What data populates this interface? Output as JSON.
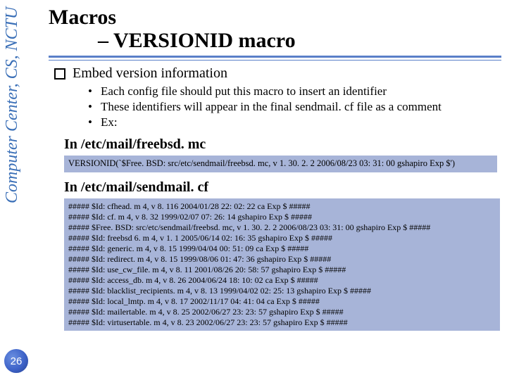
{
  "sidebar": {
    "label": "Computer Center, CS, NCTU"
  },
  "page_number": "26",
  "title": "Macros",
  "subtitle": "– VERSIONID macro",
  "bullet": "Embed version information",
  "subpoints": [
    "Each config file should put this macro to insert an identifier",
    "These identifiers will appear in the final sendmail. cf file as a comment",
    "Ex:"
  ],
  "heading_mc": "In /etc/mail/freebsd. mc",
  "mc_line": "VERSIONID(`$Free. BSD: src/etc/sendmail/freebsd. mc, v 1. 30. 2. 2 2006/08/23 03: 31: 00 gshapiro Exp $')",
  "heading_cf": "In /etc/mail/sendmail. cf",
  "cf_lines": [
    "#####  $Id: cfhead. m 4, v 8. 116 2004/01/28 22: 02: 22 ca Exp $  #####",
    "#####  $Id: cf. m 4, v 8. 32 1999/02/07 07: 26: 14 gshapiro Exp $  #####",
    "#####  $Free. BSD: src/etc/sendmail/freebsd. mc, v 1. 30. 2. 2 2006/08/23 03: 31: 00 gshapiro Exp $  #####",
    "#####  $Id: freebsd 6. m 4, v 1. 1 2005/06/14 02: 16: 35 gshapiro Exp $  #####",
    "#####  $Id: generic. m 4, v 8. 15 1999/04/04 00: 51: 09 ca Exp $  #####",
    "#####  $Id: redirect. m 4, v 8. 15 1999/08/06 01: 47: 36 gshapiro Exp $  #####",
    "#####  $Id: use_cw_file. m 4, v 8. 11 2001/08/26 20: 58: 57 gshapiro Exp $  #####",
    "#####  $Id: access_db. m 4, v 8. 26 2004/06/24 18: 10: 02 ca Exp $  #####",
    "#####  $Id: blacklist_recipients. m 4, v 8. 13 1999/04/02 02: 25: 13 gshapiro Exp $  #####",
    "#####  $Id: local_lmtp. m 4, v 8. 17 2002/11/17 04: 41: 04 ca Exp $  #####",
    "#####  $Id: mailertable. m 4, v 8. 25 2002/06/27 23: 23: 57 gshapiro Exp $  #####",
    "#####  $Id: virtusertable. m 4, v 8. 23 2002/06/27 23: 23: 57 gshapiro Exp $  #####"
  ]
}
